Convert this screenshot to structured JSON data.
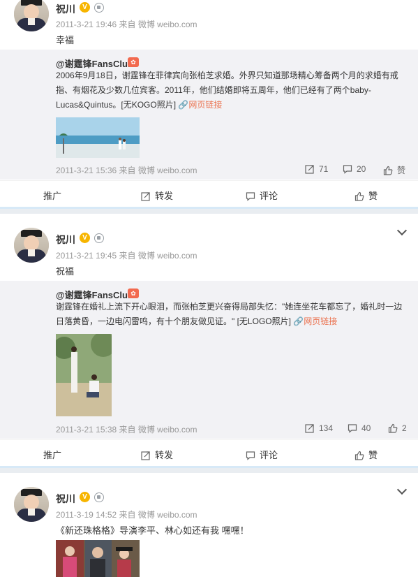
{
  "colors": {
    "accent": "#eb7350",
    "vip": "#f7b500",
    "meta": "#999999",
    "retweet_bg": "#f2f2f5",
    "page_bg": "#e9edf1"
  },
  "posts": [
    {
      "author": "祝川",
      "meta": "2011-3-21 19:46 来自 微博 weibo.com",
      "text": "幸福",
      "retweet": {
        "user": "@谢霆锋FansClub",
        "text": "2006年9月18日，谢霆锋在菲律宾向张柏芝求婚。外界只知道那场精心筹备两个月的求婚有戒指、有烟花及少数几位宾客。2011年，他们结婚即将五周年，他们已经有了两个baby-Lucas&Quintus。[无KOGO照片]",
        "link_text": "网页链接",
        "meta": "2011-3-21 15:36 来自 微博 weibo.com",
        "reposts": "71",
        "comments": "20",
        "likes": "赞"
      }
    },
    {
      "author": "祝川",
      "meta": "2011-3-21 19:45 来自 微博 weibo.com",
      "text": "祝福",
      "retweet": {
        "user": "@谢霆锋FansClub",
        "text": "谢霆锋在婚礼上流下开心眼泪，而张柏芝更兴奋得局部失忆：\"她连坐花车都忘了，婚礼时一边日落黄昏，一边电闪雷鸣，有十个朋友做见证。\" [无LOGO照片]",
        "link_text": "网页链接",
        "meta": "2011-3-21 15:38 来自 微博 weibo.com",
        "reposts": "134",
        "comments": "40",
        "likes": "2"
      }
    },
    {
      "author": "祝川",
      "meta": "2011-3-19 14:52 来自 微博 weibo.com",
      "text": "《新还珠格格》导演李平、林心如还有我 嘿嘿！"
    }
  ],
  "actions": {
    "promote": "推广",
    "repost": "转发",
    "comment": "评论",
    "like": "赞"
  },
  "icons": {
    "vip": "vip-v-icon",
    "member": "member-badge-icon",
    "more": "chevron-down-icon",
    "repost": "repost-icon",
    "comment": "comment-icon",
    "like": "thumbs-up-icon",
    "link": "link-icon"
  }
}
